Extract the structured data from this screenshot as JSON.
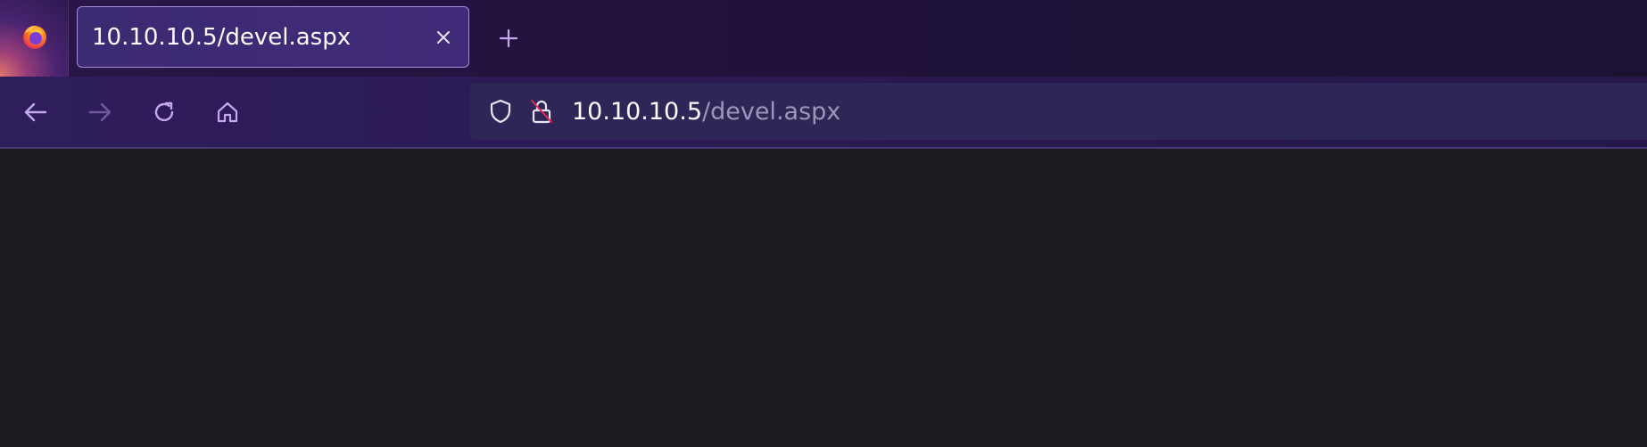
{
  "tab": {
    "title": "10.10.10.5/devel.aspx"
  },
  "urlbar": {
    "host": "10.10.10.5",
    "path": "/devel.aspx"
  },
  "icons": {
    "menu": "firefox-logo-icon",
    "close": "close-icon",
    "new_tab": "plus-icon",
    "back": "arrow-left-icon",
    "forward": "arrow-right-icon",
    "reload": "reload-icon",
    "home": "home-icon",
    "tracking": "shield-icon",
    "security": "insecure-lock-icon"
  },
  "colors": {
    "accent": "#c5a8f0",
    "tab_border": "#a48ce0",
    "insecure_slash": "#e22850",
    "page_background": "#1c1b22"
  }
}
